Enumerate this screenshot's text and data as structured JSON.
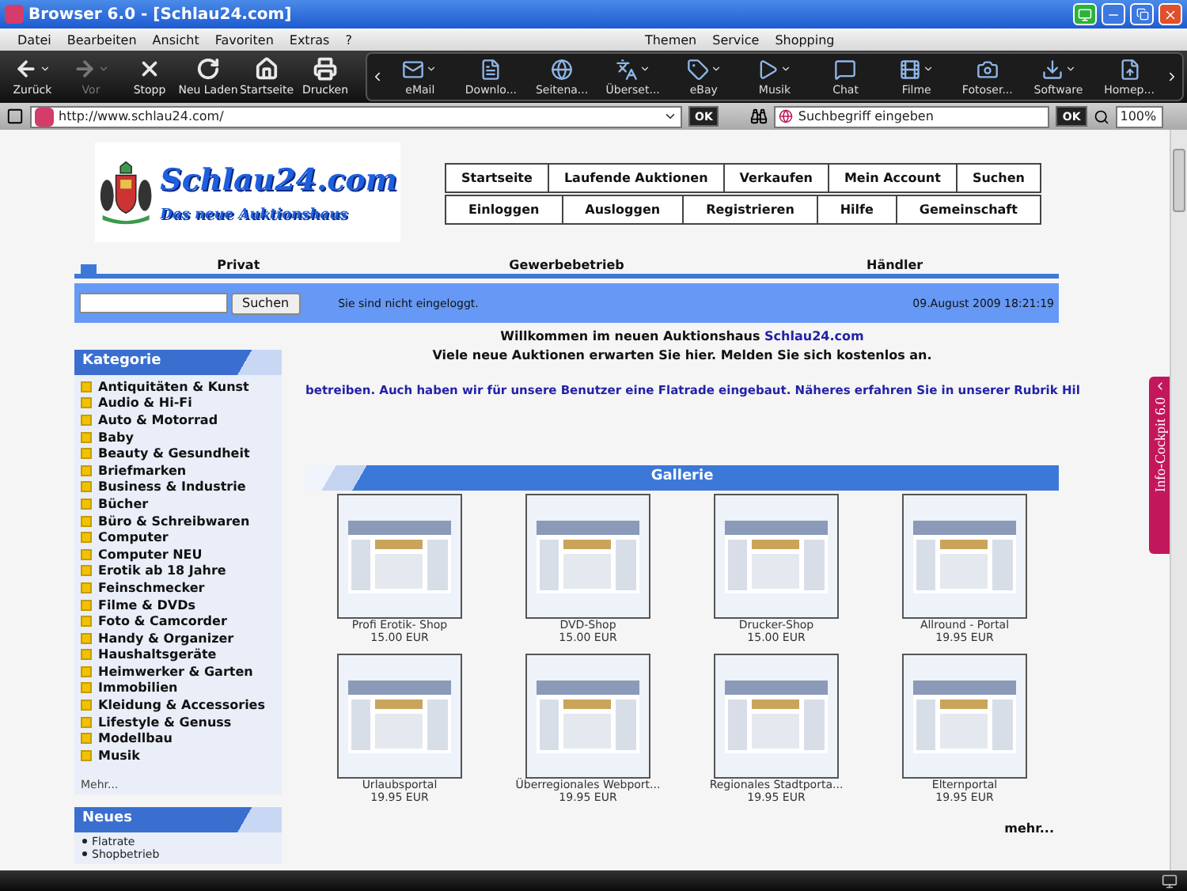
{
  "window": {
    "title": "Browser 6.0 - [Schlau24.com]"
  },
  "menu_bar": {
    "left": [
      "Datei",
      "Bearbeiten",
      "Ansicht",
      "Favoriten",
      "Extras",
      "?"
    ],
    "right": [
      "Themen",
      "Service",
      "Shopping"
    ]
  },
  "toolbar": {
    "nav": [
      {
        "label": "Zurück",
        "kind": "back",
        "dropdown": true,
        "disabled": false
      },
      {
        "label": "Vor",
        "kind": "forward",
        "dropdown": true,
        "disabled": true
      },
      {
        "label": "Stopp",
        "kind": "stop",
        "dropdown": false,
        "disabled": false
      },
      {
        "label": "Neu Laden",
        "kind": "reload",
        "dropdown": false,
        "disabled": false
      },
      {
        "label": "Startseite",
        "kind": "home",
        "dropdown": false,
        "disabled": false
      },
      {
        "label": "Drucken",
        "kind": "print",
        "dropdown": false,
        "disabled": false
      }
    ],
    "services": [
      {
        "label": "eMail",
        "kind": "mail",
        "dropdown": true
      },
      {
        "label": "Downlo...",
        "kind": "document",
        "dropdown": false
      },
      {
        "label": "Seitena...",
        "kind": "globe",
        "dropdown": false
      },
      {
        "label": "Überset...",
        "kind": "translate",
        "dropdown": true
      },
      {
        "label": "eBay",
        "kind": "tag",
        "dropdown": true
      },
      {
        "label": "Musik",
        "kind": "play",
        "dropdown": true
      },
      {
        "label": "Chat",
        "kind": "chat",
        "dropdown": false
      },
      {
        "label": "Filme",
        "kind": "film",
        "dropdown": true
      },
      {
        "label": "Fotoser...",
        "kind": "camera",
        "dropdown": false
      },
      {
        "label": "Software",
        "kind": "download",
        "dropdown": true
      },
      {
        "label": "Homep...",
        "kind": "homepage",
        "dropdown": false
      }
    ]
  },
  "address_bar": {
    "url": "http://www.schlau24.com/",
    "ok": "OK",
    "search": {
      "placeholder": "Suchbegriff eingeben"
    },
    "search_ok": "OK",
    "zoom": "100%"
  },
  "side_tab": "Info-Cockpit 6.0",
  "page": {
    "logo": {
      "title": "Schlau24.com",
      "subtitle": "Das neue Auktionshaus"
    },
    "nav_rows": [
      [
        "Startseite",
        "Laufende Auktionen",
        "Verkaufen",
        "Mein Account",
        "Suchen"
      ],
      [
        "Einloggen",
        "Ausloggen",
        "Registrieren",
        "Hilfe",
        "Gemeinschaft"
      ]
    ],
    "sections": [
      "Privat",
      "Gewerbebetrieb",
      "Händler"
    ],
    "search_bar": {
      "button": "Suchen",
      "status": "Sie sind nicht eingeloggt.",
      "datetime": "09.August 2009 18:21:19"
    },
    "sidebar": {
      "categories": {
        "title": "Kategorie",
        "items": [
          "Antiquitäten & Kunst",
          "Audio & Hi-Fi",
          "Auto & Motorrad",
          "Baby",
          "Beauty & Gesundheit",
          "Briefmarken",
          "Business & Industrie",
          "Bücher",
          "Büro & Schreibwaren",
          "Computer",
          "Computer NEU",
          "Erotik ab 18 Jahre",
          "Feinschmecker",
          "Filme & DVDs",
          "Foto & Camcorder",
          "Handy & Organizer",
          "Haushaltsgeräte",
          "Heimwerker & Garten",
          "Immobilien",
          "Kleidung & Accessories",
          "Lifestyle & Genuss",
          "Modellbau",
          "Musik"
        ],
        "more": "Mehr..."
      },
      "news": {
        "title": "Neues",
        "items": [
          "Flatrate",
          "Shopbetrieb"
        ]
      }
    },
    "welcome": {
      "line1": "Willkommen im neuen Auktionshaus",
      "link": "Schlau24.com",
      "line2": "Viele neue Auktionen erwarten Sie hier. Melden Sie sich kostenlos an."
    },
    "ticker": "betreiben. Auch haben wir für unsere Benutzer eine Flatrade eingebaut. Näheres erfahren Sie in unserer Rubrik Hil",
    "gallery": {
      "title": "Gallerie",
      "items": [
        {
          "name": "Profi Erotik- Shop",
          "price": "15.00 EUR"
        },
        {
          "name": "DVD-Shop",
          "price": "15.00 EUR"
        },
        {
          "name": "Drucker-Shop",
          "price": "15.00 EUR"
        },
        {
          "name": "Allround - Portal",
          "price": "19.95 EUR"
        },
        {
          "name": "Urlaubsportal",
          "price": "19.95 EUR"
        },
        {
          "name": "Überregionales Webport...",
          "price": "19.95 EUR"
        },
        {
          "name": "Regionales Stadtporta...",
          "price": "19.95 EUR"
        },
        {
          "name": "Elternportal",
          "price": "19.95 EUR"
        }
      ],
      "more": "mehr..."
    }
  }
}
